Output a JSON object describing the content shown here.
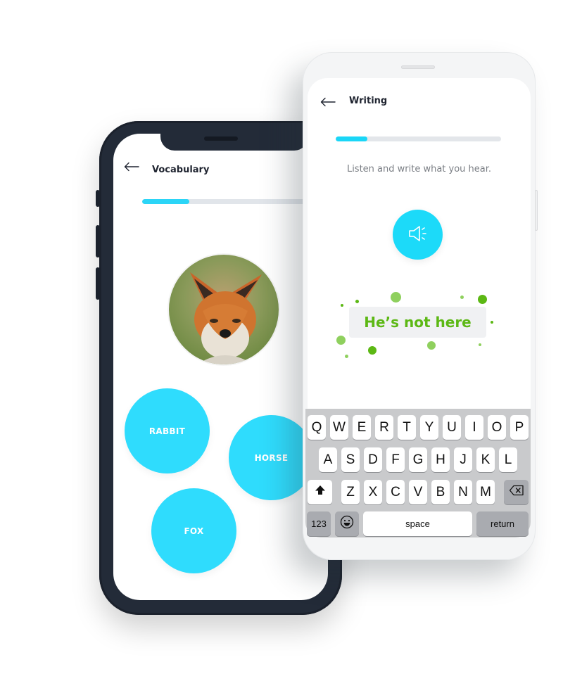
{
  "vocabulary_screen": {
    "title": "Vocabulary",
    "back_icon": "arrow-left-icon",
    "progress": 0.28,
    "image": "fox-photo",
    "choices": [
      "RABBIT",
      "HORSE",
      "FOX"
    ]
  },
  "writing_screen": {
    "title": "Writing",
    "back_icon": "arrow-left-icon",
    "progress": 0.19,
    "instruction": "Listen and write what you hear.",
    "audio_icon": "speaker-icon",
    "answer": "He’s not here"
  },
  "keyboard": {
    "row1": [
      "Q",
      "W",
      "E",
      "R",
      "T",
      "Y",
      "U",
      "I",
      "O",
      "P"
    ],
    "row2": [
      "A",
      "S",
      "D",
      "F",
      "G",
      "H",
      "J",
      "K",
      "L"
    ],
    "row3": [
      "Z",
      "X",
      "C",
      "V",
      "B",
      "N",
      "M"
    ],
    "shift_icon": "shift-icon",
    "backspace_icon": "backspace-icon",
    "numbers_label": "123",
    "emoji_icon": "emoji-icon",
    "space_label": "space",
    "return_label": "return"
  },
  "colors": {
    "accent": "#2bd5f7",
    "success": "#5cb814",
    "phone_dark": "#232b38"
  }
}
